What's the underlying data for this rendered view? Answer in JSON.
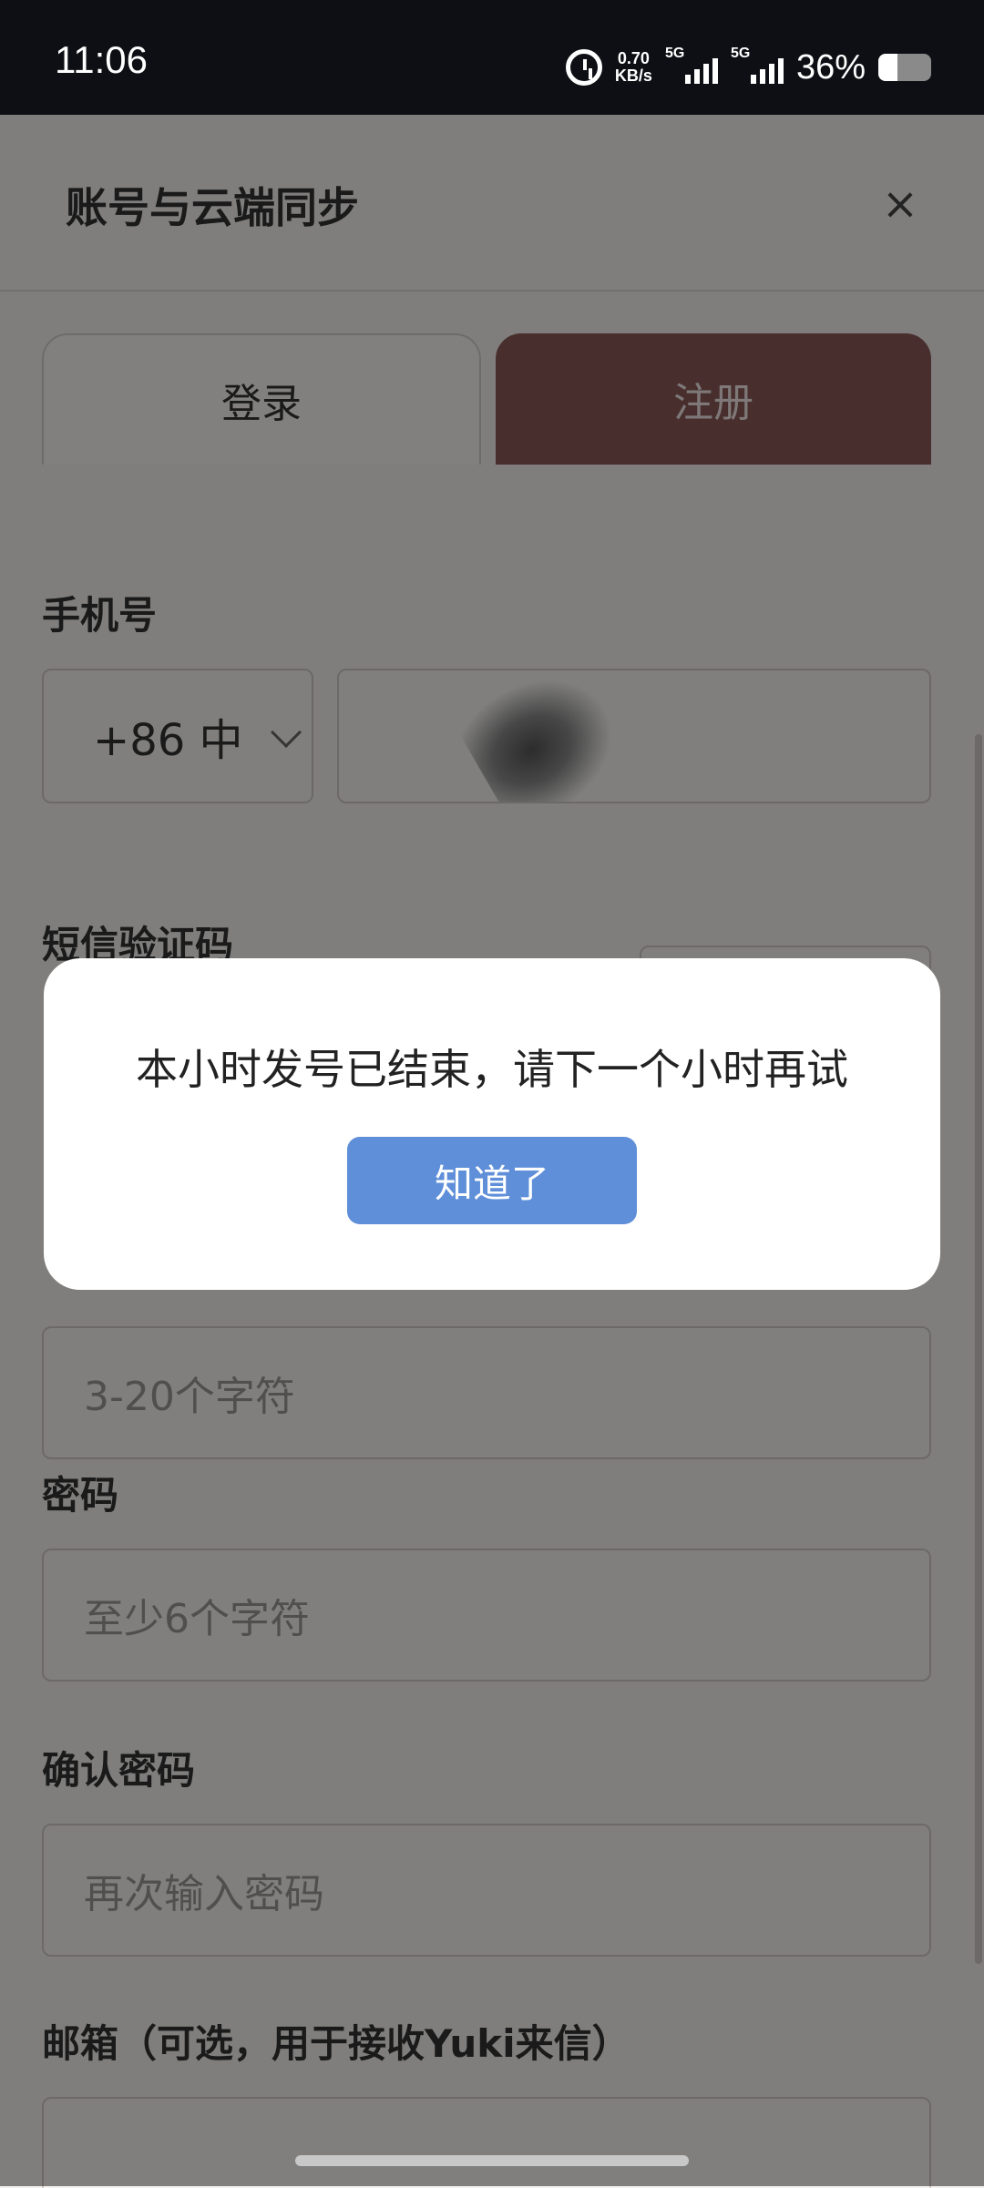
{
  "status_bar": {
    "time": "11:06",
    "net_speed_value": "0.70",
    "net_speed_unit": "KB/s",
    "sim1_tag": "5G",
    "sim2_tag": "5G",
    "battery_percent": "36%",
    "battery_level": 0.36
  },
  "header": {
    "title": "账号与云端同步",
    "close_glyph": "×"
  },
  "tabs": [
    {
      "label": "登录",
      "active": false
    },
    {
      "label": "注册",
      "active": true
    }
  ],
  "form": {
    "phone_label": "手机号",
    "country_code": "+86 中",
    "sms_label": "短信验证码",
    "username_placeholder": "3-20个字符",
    "password_label": "密码",
    "password_placeholder": "至少6个字符",
    "confirm_label": "确认密码",
    "confirm_placeholder": "再次输入密码",
    "email_label": "邮箱（可选，用于接收Yuki来信）"
  },
  "dialog": {
    "message": "本小时发号已结束，请下一个小时再试",
    "ok_label": "知道了"
  },
  "colors": {
    "register_tab": "#8a5a59",
    "dialog_button": "#5e8fd8"
  }
}
